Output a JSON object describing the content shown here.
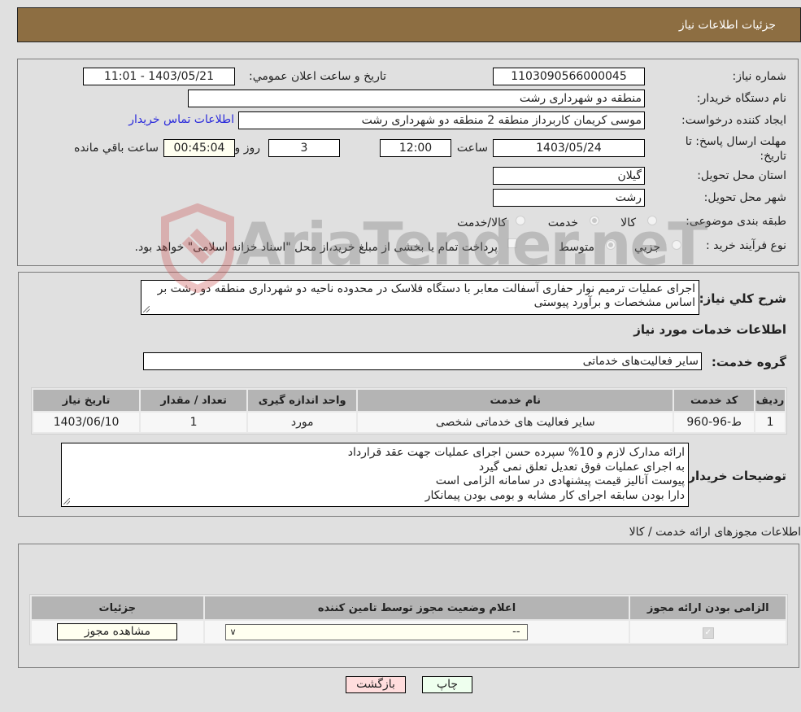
{
  "header": {
    "title": "جزئیات اطلاعات نیاز"
  },
  "info": {
    "need_number_label": "شماره نیاز:",
    "need_number": "1103090566000045",
    "announce_label": "تاریخ و ساعت اعلان عمومي:",
    "announce_value": "1403/05/21 - 11:01",
    "buyer_org_label": "نام دستگاه خریدار:",
    "buyer_org": "منطقه دو شهرداری رشت",
    "requester_label": "ایجاد کننده درخواست:",
    "requester": "موسی کریمان کاربرداز منطقه 2 منطقه دو شهرداری رشت",
    "contact_link": "اطلاعات تماس خریدار",
    "deadline_label": "مهلت ارسال پاسخ: تا تاریخ:",
    "deadline_date": "1403/05/24",
    "time_label": "ساعت",
    "deadline_time": "12:00",
    "days_value": "3",
    "days_label": "روز و",
    "remaining_time": "00:45:04",
    "remaining_label": "ساعت باقي مانده",
    "province_label": "استان محل تحویل:",
    "province": "گیلان",
    "city_label": "شهر محل تحویل:",
    "city": "رشت",
    "category_label": "طبقه بندی موضوعی:",
    "category_options": [
      {
        "label": "کالا",
        "checked": false
      },
      {
        "label": "خدمت",
        "checked": true
      },
      {
        "label": "کالا/خدمت",
        "checked": false
      }
    ],
    "process_label": "نوع فرآیند خرید :",
    "process_options": [
      {
        "label": "جزيي",
        "checked": false
      },
      {
        "label": "متوسط",
        "checked": true
      }
    ],
    "treasury_checkbox_label": "پرداخت تمام یا بخشی از مبلغ خرید،از محل \"اسناد خزانه اسلامی\" خواهد بود.",
    "treasury_checked": false
  },
  "details": {
    "description_label": "شرح كلي نياز:",
    "description": "اجرای عملیات ترمیم نوار حفاری آسفالت معابر با دستگاه فلاسک در محدوده ناحیه دو شهرداری منطقه دو رشت بر اساس مشخصات و برآورد پیوستی",
    "services_heading": "اطلاعات خدمات مورد نیاز",
    "service_group_label": "گروه خدمت:",
    "service_group": "سایر فعالیت‌های خدماتی",
    "table": {
      "headers": [
        "ردیف",
        "کد خدمت",
        "نام خدمت",
        "واحد اندازه گیری",
        "تعداد / مقدار",
        "تاریخ نیاز"
      ],
      "rows": [
        [
          "1",
          "ط-96-960",
          "سایر فعالیت های خدماتی شخصی",
          "مورد",
          "1",
          "1403/06/10"
        ]
      ]
    },
    "buyer_notes_label": "توضیحات خریدار:",
    "buyer_notes": [
      "ارائه مدارک لازم و 10% سپرده حسن اجرای عملیات جهت عقد قرارداد",
      "به اجرای عملیات فوق تعدیل تعلق نمی گیرد",
      "پیوست آنالیز قیمت پیشنهادی در سامانه الزامی است",
      "دارا بودن سابقه اجرای کار مشابه و بومی بودن پیمانکار"
    ]
  },
  "licenses": {
    "heading": "اطلاعات مجوزهای ارائه خدمت / کالا",
    "headers": [
      "الزامی بودن ارائه مجوز",
      "اعلام وضعیت مجوز توسط تامین کننده",
      "جزئیات"
    ],
    "row": {
      "required_checked": true,
      "status_selected": "--",
      "view_button": "مشاهده مجوز"
    }
  },
  "footer": {
    "print_button": "چاپ",
    "back_button": "بازگشت"
  },
  "watermark": {
    "text": "AriaTender.neT"
  },
  "colors": {
    "header_bg": "#8d6e42",
    "link": "#2a2adb",
    "print_bg": "#eeffee",
    "back_bg": "#ffdddd",
    "remaining_bg": "#fffff0"
  }
}
